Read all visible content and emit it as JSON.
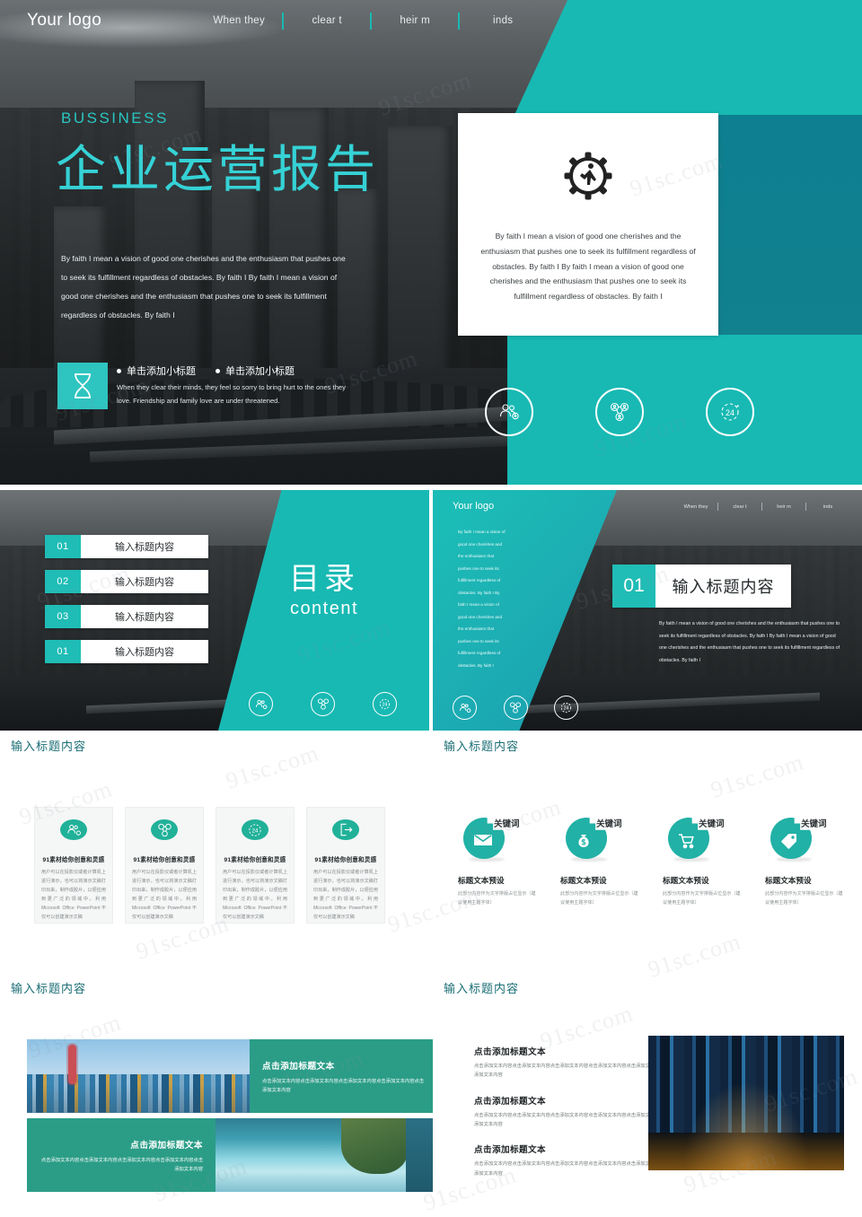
{
  "colors": {
    "teal": "#18b9b3",
    "teal_dark": "#0d7f90",
    "teal_green": "#21b199",
    "title_teal": "#1a6e75",
    "hero_title": "#35d2d6"
  },
  "hero": {
    "logo": "Your logo",
    "nav": [
      "When they",
      "clear t",
      "heir m",
      "inds"
    ],
    "eyebrow": "BUSSINESS",
    "title": "企业运营报告",
    "paragraph": "By faith I mean a vision of good one cherishes and the enthusiasm that pushes one to seek its fulfillment regardless of obstacles. By faith I By faith I mean a vision of good one cherishes and the enthusiasm that pushes one to seek its fulfillment regardless of obstacles. By faith I",
    "bullet_icon": "hourglass-icon",
    "bullets": [
      "单击添加小标题",
      "单击添加小标题"
    ],
    "bullet_sub": "When they clear their minds, they feel so sorry to bring hurt to the ones they love. Friendship and family love are under threatened.",
    "card": {
      "icon": "gear-runner-icon",
      "text": "By faith I mean a vision of good one cherishes and the enthusiasm that pushes one to seek its fulfillment regardless of obstacles. By faith I By faith I mean a vision of good one cherishes and the enthusiasm that pushes one to seek its fulfillment regardless of obstacles. By faith I"
    },
    "circle_icons": [
      "users-add-icon",
      "network-people-icon",
      "24-hours-icon"
    ]
  },
  "toc_slide": {
    "title_cn": "目录",
    "title_en": "content",
    "rows": [
      {
        "num": "01",
        "label": "输入标题内容"
      },
      {
        "num": "02",
        "label": "输入标题内容"
      },
      {
        "num": "03",
        "label": "输入标题内容"
      },
      {
        "num": "01",
        "label": "输入标题内容"
      }
    ],
    "circle_icons": [
      "users-add-icon",
      "network-people-icon",
      "24-hours-icon"
    ]
  },
  "detail_slide": {
    "logo": "Your logo",
    "nav": [
      "When they",
      "clear t",
      "heir m",
      "inds"
    ],
    "side_text": "By faith I mean a vision of good one cherishes and the enthusiasm that pushes one to seek its fulfillment regardless of obstacles. By faith I By faith I mean a vision of good one cherishes and the enthusiasm that pushes one to seek its fulfillment regardless of obstacles. By faith I",
    "num": "01",
    "label": "输入标题内容",
    "paragraph": "By faith I mean a vision of good one cherishes and the enthusiasm that pushes one to seek its fulfillment regardless of obstacles. By faith I By faith I mean a vision of good one cherishes and the enthusiasm that pushes one to seek its fulfillment regardless of obstacles. By faith I",
    "circle_icons": [
      "users-add-icon",
      "network-people-icon",
      "24-hours-icon"
    ]
  },
  "cards_slide": {
    "title": "输入标题内容",
    "cards": [
      {
        "icon": "users-add-icon",
        "title": "91素材给你创意和灵感",
        "body": "用户可以在投影仪或者计算机上进行演示，也可以将演示文稿打印出来，制作成胶片，以便应用到更广泛的领域中。利用 Microsoft Office PowerPoint不仅可以创建演示文稿"
      },
      {
        "icon": "network-people-icon",
        "title": "91素材给你创意和灵感",
        "body": "用户可以在投影仪或者计算机上进行演示，也可以将演示文稿打印出来，制作成胶片，以便应用到更广泛的领域中。利用 Microsoft Office PowerPoint不仅可以创建演示文稿"
      },
      {
        "icon": "24-hours-icon",
        "title": "91素材给你创意和灵感",
        "body": "用户可以在投影仪或者计算机上进行演示，也可以将演示文稿打印出来，制作成胶片，以便应用到更广泛的领域中。利用 Microsoft Office PowerPoint不仅可以创建演示文稿"
      },
      {
        "icon": "exit-door-icon",
        "title": "91素材给你创意和灵感",
        "body": "用户可以在投影仪或者计算机上进行演示，也可以将演示文稿打印出来，制作成胶片，以便应用到更广泛的领域中。利用 Microsoft Office PowerPoint不仅可以创建演示文稿"
      }
    ]
  },
  "keywords_slide": {
    "title": "输入标题内容",
    "items": [
      {
        "icon": "envelope-icon",
        "word": "关键词",
        "title": "标题文本预设",
        "body": "此部分内容作为文字排版占位显示（建议使用主题字体）"
      },
      {
        "icon": "money-bag-icon",
        "word": "关键词",
        "title": "标题文本预设",
        "body": "此部分内容作为文字排版占位显示（建议使用主题字体）"
      },
      {
        "icon": "shopping-cart-icon",
        "word": "关键词",
        "title": "标题文本预设",
        "body": "此部分内容作为文字排版占位显示（建议使用主题字体）"
      },
      {
        "icon": "price-tag-icon",
        "word": "关键词",
        "title": "标题文本预设",
        "body": "此部分内容作为文字排版占位显示（建议使用主题字体）"
      }
    ]
  },
  "images_slide": {
    "title": "输入标题内容",
    "block_top": {
      "image": "shanghai-skyline-day-photo",
      "heading": "点击添加标题文本",
      "body": "点击添加文本内容点击添加文本内容点击添加文本内容点击添加文本内容点击添加文本内容"
    },
    "block_bottom": {
      "image": "lake-waterfall-photo",
      "heading": "点击添加标题文本",
      "body": "点击添加文本内容点击添加文本内容点击添加文本内容点击添加文本内容点击添加文本内容"
    }
  },
  "textlist_slide": {
    "title": "输入标题内容",
    "image": "shanghai-night-street-photo",
    "items": [
      {
        "heading": "点击添加标题文本",
        "body": "点击添加文本内容点击添加文本内容点击添加文本内容点击添加文本内容点击添加文本内容点击添加文本内容"
      },
      {
        "heading": "点击添加标题文本",
        "body": "点击添加文本内容点击添加文本内容点击添加文本内容点击添加文本内容点击添加文本内容点击添加文本内容"
      },
      {
        "heading": "点击添加标题文本",
        "body": "点击添加文本内容点击添加文本内容点击添加文本内容点击添加文本内容点击添加文本内容点击添加文本内容"
      }
    ]
  },
  "watermark": {
    "text": "91sc.com"
  }
}
